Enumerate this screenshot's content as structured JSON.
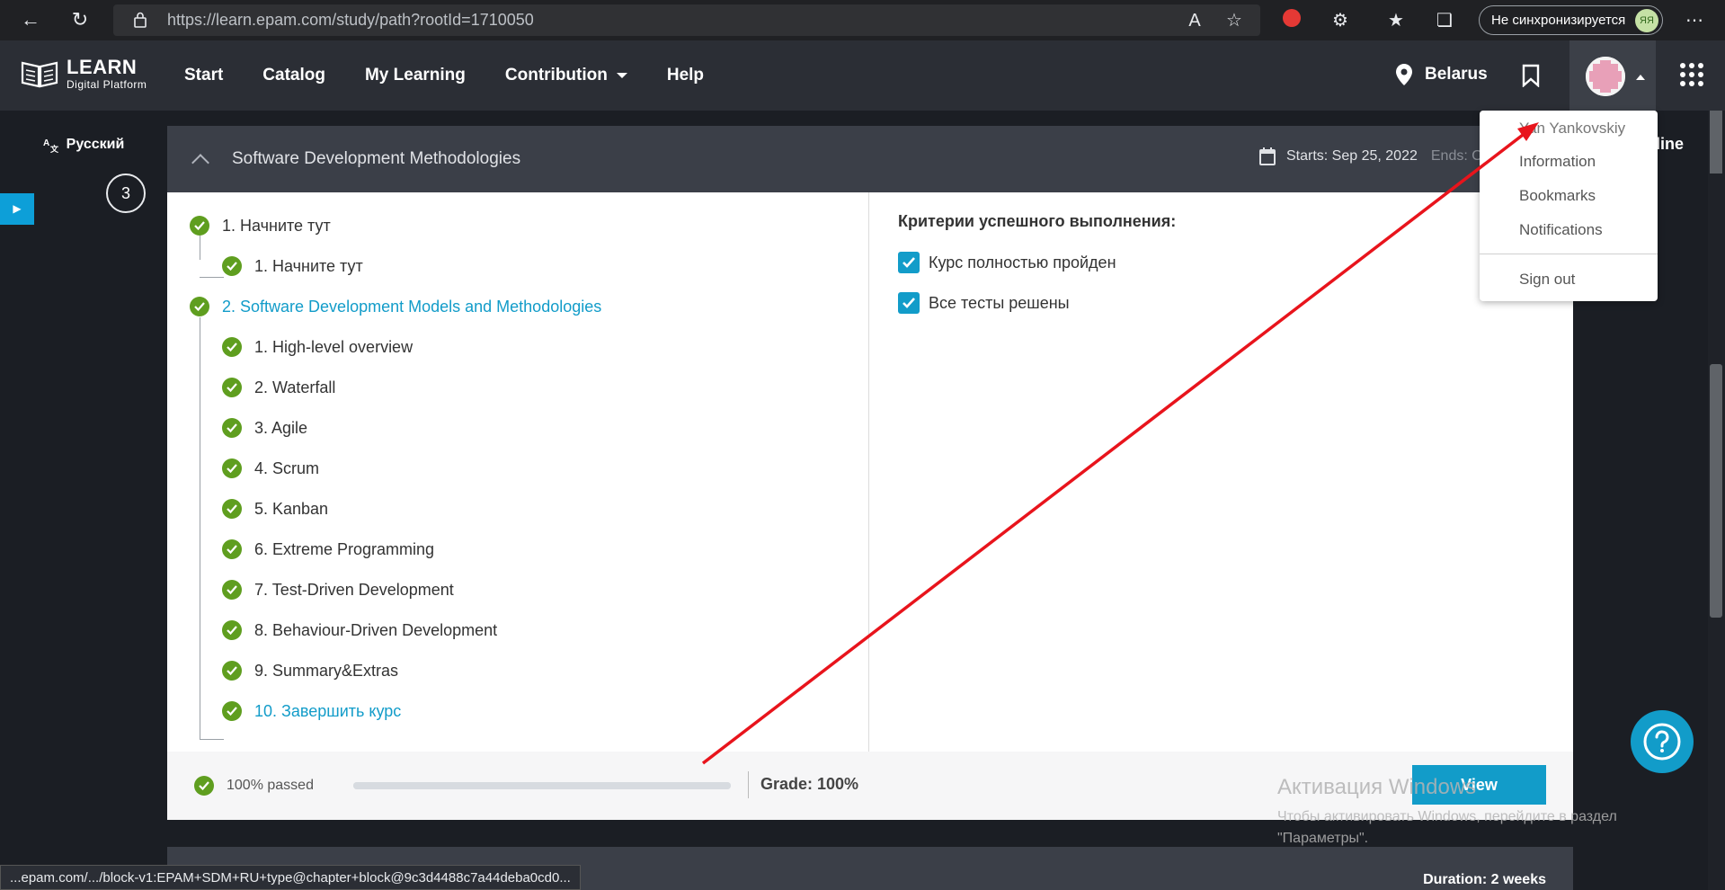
{
  "browser": {
    "url": "https://learn.epam.com/study/path?rootId=1710050",
    "sync_label": "Не синхронизируется",
    "profile_initials": "ЯЯ"
  },
  "header": {
    "logo_main": "LEARN",
    "logo_sub": "Digital Platform",
    "nav": [
      "Start",
      "Catalog",
      "My Learning",
      "Contribution",
      "Help"
    ],
    "region": "Belarus"
  },
  "sidebar": {
    "language": "Русский",
    "step_number": "3"
  },
  "course": {
    "title": "Software Development Methodologies",
    "starts": "Starts: Sep 25, 2022",
    "ends": "Ends: O",
    "tree": [
      {
        "label": "1. Начните тут",
        "level": 0,
        "link": false
      },
      {
        "label": "1. Начните тут",
        "level": 1,
        "link": false
      },
      {
        "label": "2. Software Development Models and Methodologies",
        "level": 0,
        "link": true
      },
      {
        "label": "1. High-level overview",
        "level": 1,
        "link": false
      },
      {
        "label": "2. Waterfall",
        "level": 1,
        "link": false
      },
      {
        "label": "3. Agile",
        "level": 1,
        "link": false
      },
      {
        "label": "4. Scrum",
        "level": 1,
        "link": false
      },
      {
        "label": "5. Kanban",
        "level": 1,
        "link": false
      },
      {
        "label": "6. Extreme Programming",
        "level": 1,
        "link": false
      },
      {
        "label": "7. Test-Driven Development",
        "level": 1,
        "link": false
      },
      {
        "label": "8. Behaviour-Driven Development",
        "level": 1,
        "link": false
      },
      {
        "label": "9. Summary&Extras",
        "level": 1,
        "link": false
      },
      {
        "label": "10. Завершить курс",
        "level": 1,
        "link": true
      }
    ],
    "criteria_title": "Критерии успешного выполнения:",
    "criteria": [
      "Курс полностью пройден",
      "Все тесты решены"
    ],
    "passed": "100% passed",
    "progress_fraction": 1.0,
    "grade": "Grade: 100%",
    "view_label": "View",
    "next_duration": "Duration: 2 weeks",
    "pipeline_partial": "eline"
  },
  "user_menu": {
    "name": "Yan Yankovskiy",
    "items": [
      "Information",
      "Bookmarks",
      "Notifications"
    ],
    "sign_out": "Sign out"
  },
  "watermark": {
    "title": "Активация Windows",
    "subtitle": "Чтобы активировать Windows, перейдите в раздел \"Параметры\"."
  },
  "status_url": "...epam.com/.../block-v1:EPAM+SDM+RU+type@chapter+block@9c3d4488c7a44deba0cd0...",
  "colors": {
    "accent": "#129cc9",
    "check_green": "#5f9e1f",
    "annotation_arrow": "#e8141c"
  }
}
